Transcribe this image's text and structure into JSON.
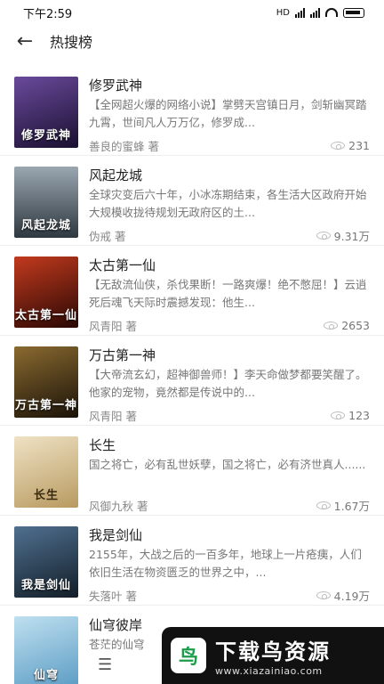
{
  "status_bar": {
    "time": "下午2:59",
    "network": "HD"
  },
  "app_bar": {
    "title": "热搜榜"
  },
  "books": [
    {
      "title": "修罗武神",
      "desc": "【全网超火爆的网络小说】掌劈天宫镇日月，剑斩幽冥踏九霄，世间凡人万万亿，修罗成...",
      "author": "善良的蜜蜂 著",
      "views": "231",
      "cover_text": "修罗武神",
      "cover_color": "#3a2a5c"
    },
    {
      "title": "风起龙城",
      "desc": "全球灾变后六十年，小冰冻期结束，各生活大区政府开始大规模收拢待规划无政府区的土...",
      "author": "伪戒 著",
      "views": "9.31万",
      "cover_text": "风起龙城",
      "cover_color": "#5a6b7a"
    },
    {
      "title": "太古第一仙",
      "desc": "【无敌流仙侠，杀伐果断！一路爽爆！绝不憋屈！】云逍死后魂飞天际时震撼发现：他生...",
      "author": "风青阳 著",
      "views": "2653",
      "cover_text": "太古第一仙",
      "cover_color": "#6b1a12"
    },
    {
      "title": "万古第一神",
      "desc": "【大帝流玄幻，超神御兽师！】李天命做梦都要笑醒了。他家的宠物，竟然都是传说中的...",
      "author": "风青阳 著",
      "views": "123",
      "cover_text": "万古第一神",
      "cover_color": "#3b2a14"
    },
    {
      "title": "长生",
      "desc": "国之将亡，必有乱世妖孽，国之将亡，必有济世真人......",
      "author": "风御九秋 著",
      "views": "1.67万",
      "cover_text": "长生",
      "cover_color": "#d9c7a0"
    },
    {
      "title": "我是剑仙",
      "desc": "2155年，大战之后的一百多年，地球上一片疮痍，人们依旧生活在物资匮乏的世界之中，...",
      "author": "失落叶 著",
      "views": "4.19万",
      "cover_text": "我是剑仙",
      "cover_color": "#2c3f52"
    },
    {
      "title": "仙穹彼岸",
      "desc": "苍茫的仙穹",
      "author": "",
      "views": "",
      "cover_text": "仙穹",
      "cover_color": "#7fb6d8"
    }
  ],
  "watermark": {
    "title": "下载鸟资源",
    "url": "www.xiazainiao.com",
    "logo_glyph": "鸟"
  },
  "icons": {
    "back": "back-arrow-icon",
    "view": "eye-icon",
    "menu": "menu-icon"
  }
}
